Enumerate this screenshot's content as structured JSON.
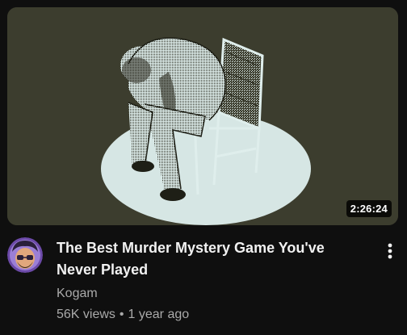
{
  "video": {
    "duration": "2:26:24",
    "title": "The Best Murder Mystery Game You've Never Played",
    "channel": "Kogam",
    "views": "56K views",
    "separator": "•",
    "age": "1 year ago"
  },
  "icons": {
    "menu": "more-vert-icon"
  },
  "colors": {
    "background": "#0f0f0f",
    "thumbnail_bg": "#3c3d2e",
    "spotlight": "#d6e6e4",
    "title": "#f1f1f1",
    "secondary_text": "#aaaaaa",
    "avatar_bg": "#6c4aa8"
  }
}
